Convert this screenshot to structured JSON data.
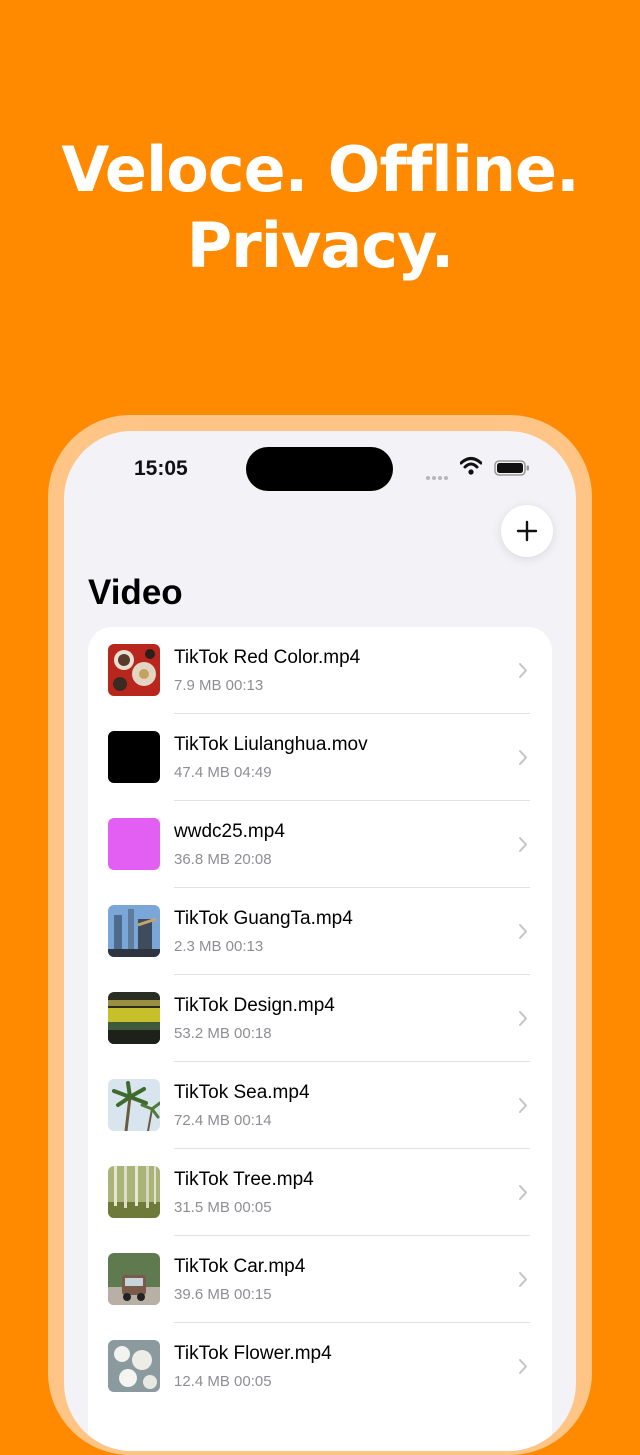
{
  "headline": {
    "line1": "Veloce. Offline.",
    "line2": "Privacy."
  },
  "status_bar": {
    "time": "15:05"
  },
  "page": {
    "title": "Video"
  },
  "videos": [
    {
      "title": "TikTok Red Color.mp4",
      "meta": "7.9 MB 00:13",
      "thumb": "red-food-thumbnail"
    },
    {
      "title": "TikTok Liulanghua.mov",
      "meta": "47.4 MB 04:49",
      "thumb": "black-thumbnail"
    },
    {
      "title": "wwdc25.mp4",
      "meta": "36.8 MB 20:08",
      "thumb": "magenta-thumbnail"
    },
    {
      "title": "TikTok GuangTa.mp4",
      "meta": "2.3 MB 00:13",
      "thumb": "tower-thumbnail"
    },
    {
      "title": "TikTok Design.mp4",
      "meta": "53.2 MB 00:18",
      "thumb": "interior-thumbnail"
    },
    {
      "title": "TikTok Sea.mp4",
      "meta": "72.4 MB 00:14",
      "thumb": "palm-thumbnail"
    },
    {
      "title": "TikTok Tree.mp4",
      "meta": "31.5 MB 00:05",
      "thumb": "forest-thumbnail"
    },
    {
      "title": "TikTok Car.mp4",
      "meta": "39.6 MB 00:15",
      "thumb": "car-thumbnail"
    },
    {
      "title": "TikTok Flower.mp4",
      "meta": "12.4 MB 00:05",
      "thumb": "flower-thumbnail"
    }
  ],
  "colors": {
    "background": "#FF8A00",
    "frame": "#FFC587",
    "screen": "#F2F2F7"
  }
}
